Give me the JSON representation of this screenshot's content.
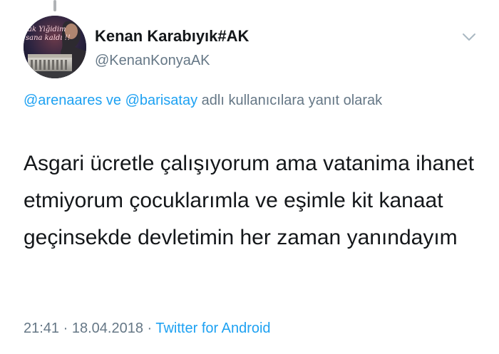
{
  "user": {
    "display_name": "Kenan Karabıyık#AK",
    "handle": "@KenanKonyaAK",
    "avatar_text_line1": "ak Yiğidim",
    "avatar_text_line2": "sana kaldı !!"
  },
  "reply": {
    "mention1": "@arenaares",
    "connector1": " ve ",
    "mention2": "@barisatay",
    "suffix": " adlı kullanıcılara yanıt olarak"
  },
  "tweet": {
    "text": "Asgari ücretle çalışıyorum ama vatanima ihanet etmiyorum çocuklarımla ve eşimle kit kanaat geçinsekde devletimin her zaman yanındayım"
  },
  "meta": {
    "time": "21:41",
    "separator1": " · ",
    "date": "18.04.2018",
    "separator2": " · ",
    "source": "Twitter for Android"
  },
  "icons": {
    "menu": "chevron-down-icon"
  },
  "colors": {
    "link": "#1da1f2",
    "secondary_text": "#657786",
    "primary_text": "#14171a",
    "background": "#ffffff"
  }
}
